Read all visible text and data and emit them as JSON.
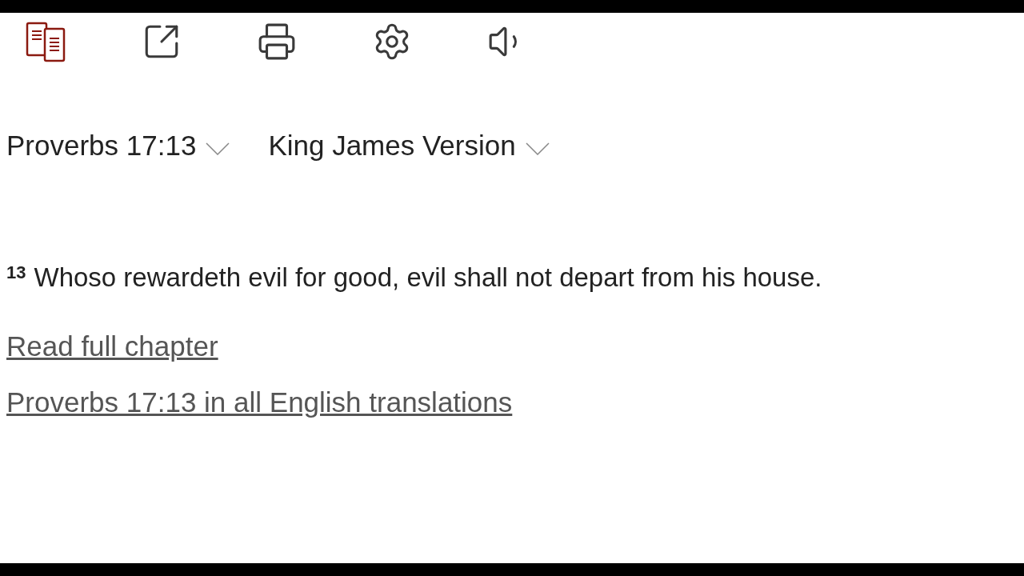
{
  "toolbar": [
    {
      "kind": "parallel",
      "on": true
    },
    {
      "kind": "share",
      "on": false
    },
    {
      "kind": "print",
      "on": false
    },
    {
      "kind": "settings",
      "on": false
    },
    {
      "kind": "audio",
      "on": false
    }
  ],
  "passage_select": {
    "value": "Proverbs 17:13"
  },
  "version_select": {
    "value": "King James Version"
  },
  "verse": {
    "number": "13",
    "text": "Whoso rewardeth evil for good, evil shall not depart from his house."
  },
  "links": [
    "Read full chapter",
    "Proverbs 17:13 in all English translations"
  ]
}
